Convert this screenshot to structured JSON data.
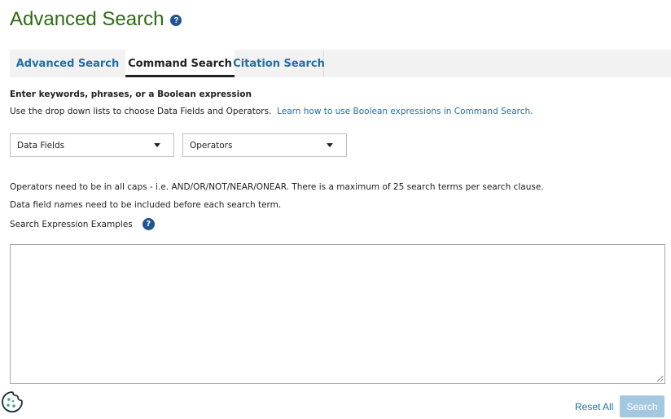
{
  "page": {
    "title": "Advanced Search",
    "title_help_glyph": "?"
  },
  "tabs": [
    {
      "label": "Advanced Search",
      "active": false
    },
    {
      "label": "Command Search",
      "active": true
    },
    {
      "label": "Citation Search",
      "active": false
    }
  ],
  "form": {
    "heading": "Enter keywords, phrases, or a Boolean expression",
    "instructions": "Use the drop down lists to choose Data Fields and Operators.",
    "learn_link": "Learn how to use Boolean expressions in Command Search.",
    "data_fields_value": "Data Fields",
    "operators_value": "Operators",
    "note_operators": "Operators need to be in all caps - i.e. AND/OR/NOT/NEAR/ONEAR. There is a maximum of 25 search terms per search clause.",
    "note_fields": "Data field names need to be included before each search term.",
    "examples_label": "Search Expression Examples",
    "examples_help_glyph": "?",
    "expression_value": ""
  },
  "actions": {
    "reset_label": "Reset All",
    "search_label": "Search"
  },
  "colors": {
    "title": "#2e6b12",
    "link": "#1f6fa6",
    "help_icon": "#205493",
    "search_button_disabled": "#a5c8e1",
    "cookie_accent": "#3fa88a"
  },
  "icons": {
    "title_help": "question-circle-icon",
    "examples_help": "question-circle-icon",
    "dropdown": "caret-down-icon",
    "cookie": "cookie-icon"
  }
}
